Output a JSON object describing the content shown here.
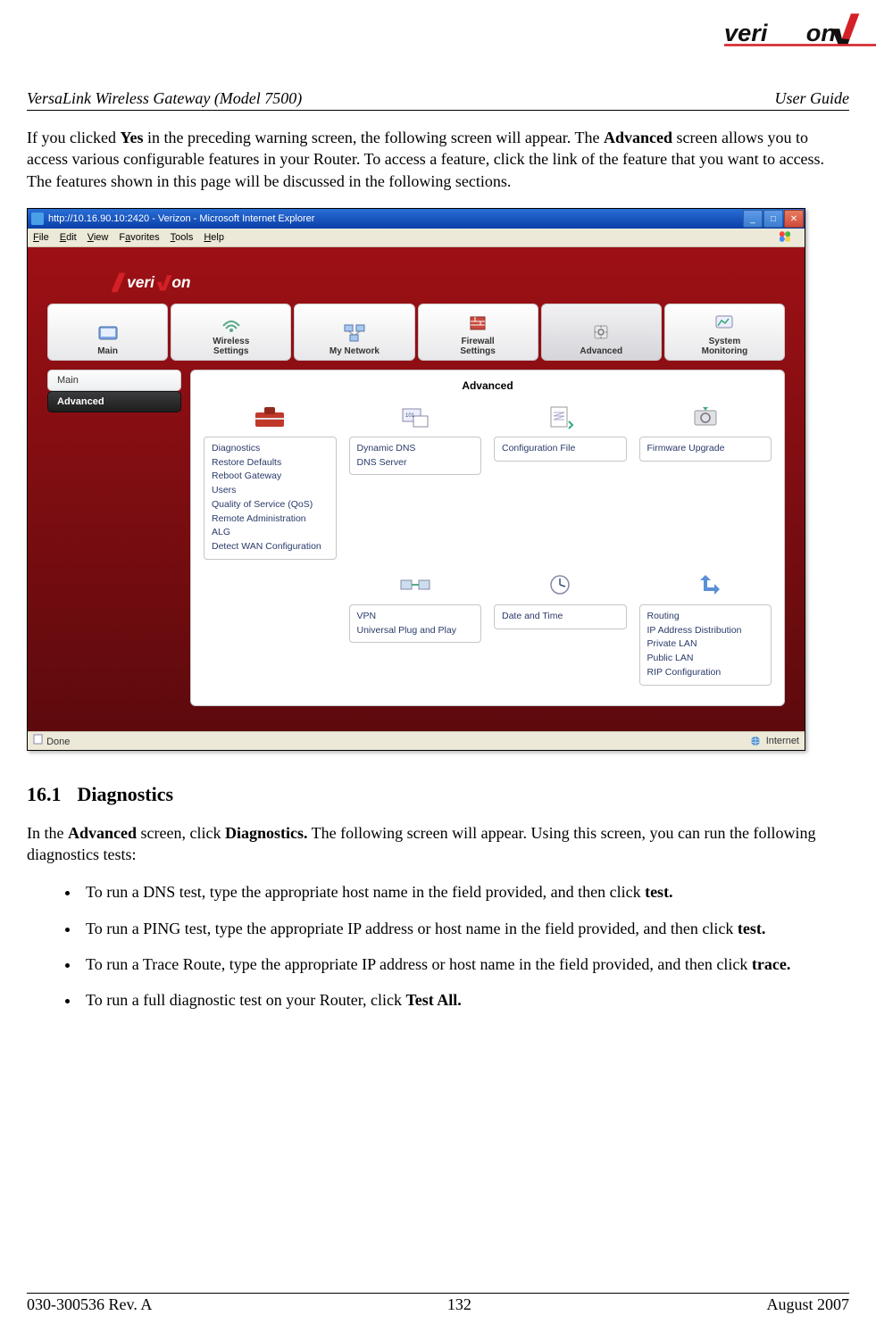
{
  "header": {
    "left": "VersaLink Wireless Gateway (Model 7500)",
    "right": "User Guide"
  },
  "intro": {
    "p1a": "If you clicked ",
    "p1b": "Yes",
    "p1c": " in the preceding warning screen, the following screen will appear. The ",
    "p1d": "Advanced",
    "p1e": " screen allows you to access various configurable features in your Router. To access a feature, click the link of the feature that you want to access. The features shown in this page will be discussed in the following sections."
  },
  "browser": {
    "title": "http://10.16.90.10:2420 - Verizon - Microsoft Internet Explorer",
    "menus": {
      "file": "File",
      "edit": "Edit",
      "view": "View",
      "favorites": "Favorites",
      "tools": "Tools",
      "help": "Help"
    },
    "status_left": "Done",
    "status_right": "Internet"
  },
  "nav": {
    "items": [
      {
        "label": "Main"
      },
      {
        "label": "Wireless\nSettings"
      },
      {
        "label": "My Network"
      },
      {
        "label": "Firewall\nSettings"
      },
      {
        "label": "Advanced"
      },
      {
        "label": "System\nMonitoring"
      }
    ]
  },
  "sidebar": {
    "items": [
      {
        "label": "Main"
      },
      {
        "label": "Advanced"
      }
    ]
  },
  "panel": {
    "title": "Advanced",
    "col1": [
      "Diagnostics",
      "Restore Defaults",
      "Reboot Gateway",
      "Users",
      "Quality of Service (QoS)",
      "Remote Administration",
      "ALG",
      "Detect WAN Configuration"
    ],
    "col2top": [
      "Dynamic DNS",
      "DNS Server"
    ],
    "col2bot": [
      "VPN",
      "Universal Plug and Play"
    ],
    "col3top": [
      "Configuration File"
    ],
    "col3bot": [
      "Date and Time"
    ],
    "col4top": [
      "Firmware Upgrade"
    ],
    "col4bot": [
      "Routing",
      "IP Address Distribution",
      "Private LAN",
      "Public LAN",
      "RIP Configuration"
    ]
  },
  "section": {
    "num": "16.1",
    "title": "Diagnostics",
    "intro_a": "In the ",
    "intro_b": "Advanced",
    "intro_c": " screen, click ",
    "intro_d": "Diagnostics.",
    "intro_e": " The following screen will appear. Using this screen, you can run the following diagnostics tests:",
    "b1a": "To run a DNS test, type the appropriate host name in the field provided, and then click ",
    "b1b": "test.",
    "b2a": "To run a PING test, type the appropriate IP address or host name in the field provided, and then click ",
    "b2b": "test.",
    "b3a": "To run a Trace Route, type the appropriate IP address or host name in the field provided, and then click ",
    "b3b": "trace.",
    "b4a": "To run a full diagnostic test on your Router, click ",
    "b4b": "Test All."
  },
  "footer": {
    "left": "030-300536 Rev. A",
    "center": "132",
    "right": "August 2007"
  }
}
